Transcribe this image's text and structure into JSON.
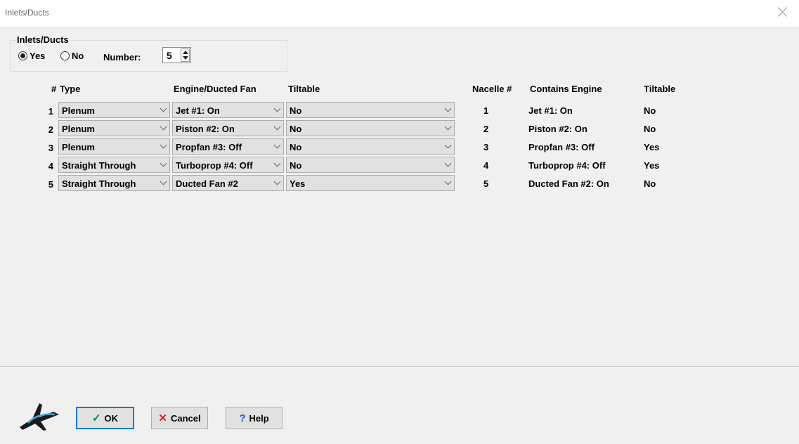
{
  "window": {
    "title": "Inlets/Ducts"
  },
  "group": {
    "legend": "Inlets/Ducts",
    "yes_label": "Yes",
    "no_label": "No",
    "selected": "Yes",
    "number_label": "Number:",
    "number_value": "5"
  },
  "table": {
    "headers": {
      "num": "#",
      "type": "Type",
      "engine": "Engine/Ducted Fan",
      "tiltable": "Tiltable"
    },
    "rows": [
      {
        "num": "1",
        "type": "Plenum",
        "engine": "Jet #1: On",
        "tiltable": "No"
      },
      {
        "num": "2",
        "type": "Plenum",
        "engine": "Piston #2: On",
        "tiltable": "No"
      },
      {
        "num": "3",
        "type": "Plenum",
        "engine": "Propfan #3: Off",
        "tiltable": "No"
      },
      {
        "num": "4",
        "type": "Straight Through",
        "engine": "Turboprop #4: Off",
        "tiltable": "No"
      },
      {
        "num": "5",
        "type": "Straight Through",
        "engine": "Ducted Fan #2",
        "tiltable": "Yes"
      }
    ]
  },
  "nacelles": {
    "headers": {
      "num": "Nacelle #",
      "engine": "Contains Engine",
      "tiltable": "Tiltable"
    },
    "rows": [
      {
        "num": "1",
        "engine": "Jet #1: On",
        "tiltable": "No"
      },
      {
        "num": "2",
        "engine": "Piston #2: On",
        "tiltable": "No"
      },
      {
        "num": "3",
        "engine": "Propfan #3: Off",
        "tiltable": "Yes"
      },
      {
        "num": "4",
        "engine": "Turboprop #4: Off",
        "tiltable": "Yes"
      },
      {
        "num": "5",
        "engine": "Ducted Fan #2: On",
        "tiltable": "No"
      }
    ]
  },
  "footer": {
    "ok_label": "OK",
    "cancel_label": "Cancel",
    "help_label": "Help",
    "ok_icon": "checkmark-icon",
    "cancel_icon": "x-icon",
    "help_icon": "question-icon",
    "colors": {
      "ok_check": "#0a8a3a",
      "cancel_x": "#d42020",
      "help_q": "#1e5fb5",
      "focus": "#0078d7"
    }
  }
}
